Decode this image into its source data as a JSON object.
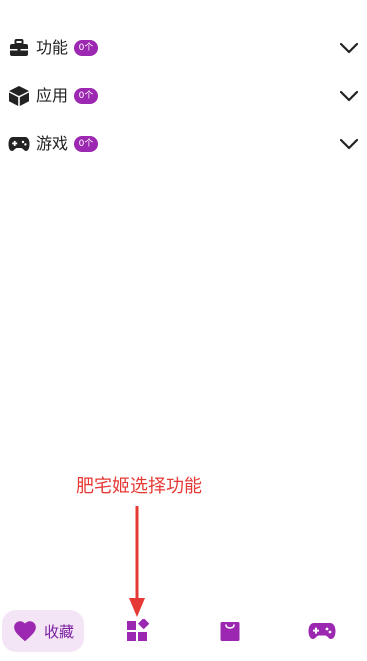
{
  "categories": [
    {
      "label": "功能",
      "badge": "0个",
      "icon": "briefcase-icon"
    },
    {
      "label": "应用",
      "badge": "0个",
      "icon": "cube-icon"
    },
    {
      "label": "游戏",
      "badge": "0个",
      "icon": "gamepad-icon"
    }
  ],
  "annotation": {
    "text": "肥宅姬选择功能"
  },
  "bottom_nav": {
    "favorites_label": "收藏",
    "items": [
      {
        "name": "favorites",
        "icon": "heart-icon",
        "active": true
      },
      {
        "name": "functions",
        "icon": "widgets-icon",
        "active": false
      },
      {
        "name": "apps",
        "icon": "shopping-bag-icon",
        "active": false
      },
      {
        "name": "games",
        "icon": "gamepad-icon",
        "active": false
      }
    ]
  },
  "colors": {
    "accent": "#9c27b0",
    "accent_light": "#f3e5f5",
    "annotation_red": "#e53935",
    "text": "#222222"
  }
}
